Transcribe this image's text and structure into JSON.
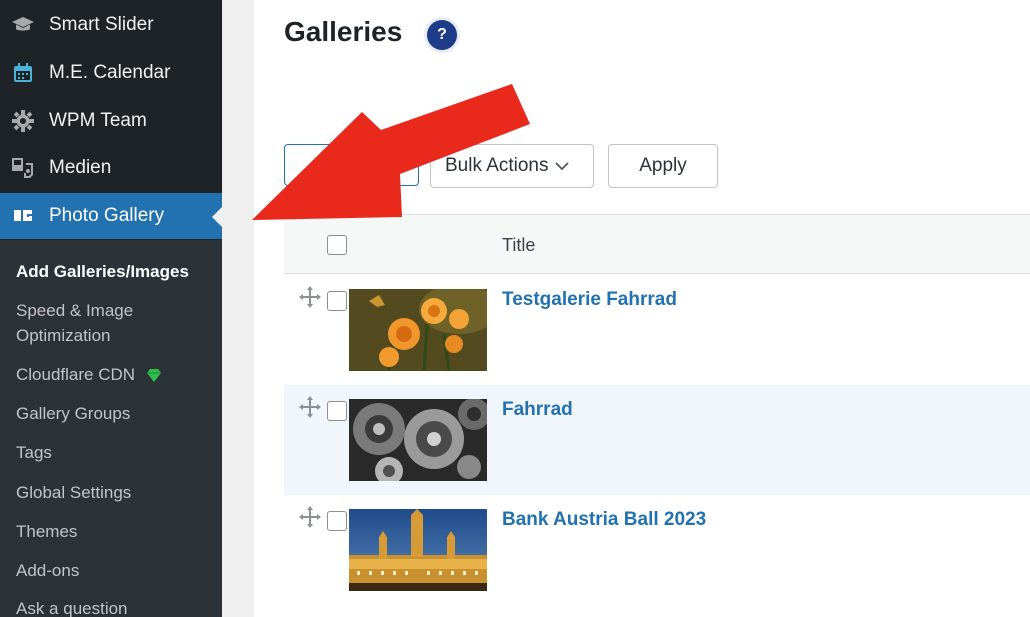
{
  "sidebar": {
    "menu": [
      {
        "label": "Smart Slider",
        "icon": "graduation-cap-icon"
      },
      {
        "label": "M.E. Calendar",
        "icon": "calendar-icon"
      },
      {
        "label": "WPM Team",
        "icon": "gear-icon"
      },
      {
        "label": "Medien",
        "icon": "media-icon"
      },
      {
        "label": "Photo Gallery",
        "icon": "photo-gallery-icon"
      }
    ],
    "submenu": [
      {
        "label": "Add Galleries/Images"
      },
      {
        "label": "Speed & Image"
      },
      {
        "label": "Optimization"
      },
      {
        "label": "Cloudflare CDN"
      },
      {
        "label": "Gallery Groups"
      },
      {
        "label": "Tags"
      },
      {
        "label": "Global Settings"
      },
      {
        "label": "Themes"
      },
      {
        "label": "Add-ons"
      },
      {
        "label": "Ask a question"
      }
    ]
  },
  "main": {
    "title": "Galleries",
    "help_label": "?",
    "toolbar": {
      "bulk_actions_label": "Bulk Actions",
      "apply_label": "Apply"
    },
    "table": {
      "column_title": "Title",
      "rows": [
        {
          "title": "Testgalerie Fahrrad",
          "thumbnail": "orange-flowers-butterfly"
        },
        {
          "title": "Fahrrad",
          "thumbnail": "bicycle-gears-bw"
        },
        {
          "title": "Bank Austria Ball 2023",
          "thumbnail": "vienna-city-hall-night"
        }
      ]
    }
  },
  "colors": {
    "sidebar_bg": "#1d2327",
    "active_menu": "#2271b1",
    "link": "#2271b1",
    "arrow": "#e8291c"
  }
}
